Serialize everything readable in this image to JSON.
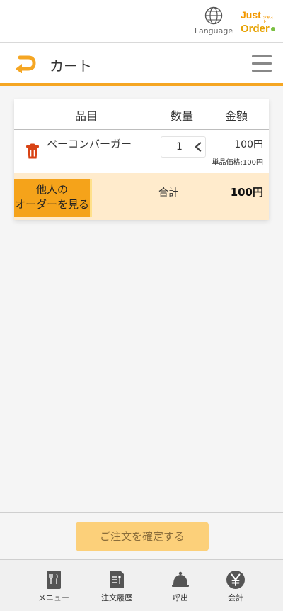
{
  "language": {
    "label": "Language"
  },
  "logo": {
    "line1": "Just",
    "line2": "Order",
    "small1": "ジャスト",
    "small2": "オーダー"
  },
  "header": {
    "title": "カート"
  },
  "cart": {
    "columns": {
      "item": "品目",
      "qty": "数量",
      "price": "金額"
    },
    "items": [
      {
        "name": "ベーコンバーガー",
        "qty": "1",
        "price": "100円",
        "unit_price": "単品価格:100円"
      }
    ],
    "others_button": {
      "line1": "他人の",
      "line2": "オーダーを見る"
    },
    "total_label": "合計",
    "total_value": "100円"
  },
  "confirm_button": "ご注文を確定する",
  "tabs": [
    {
      "label": "メニュー"
    },
    {
      "label": "注文履歴"
    },
    {
      "label": "呼出"
    },
    {
      "label": "会計"
    }
  ],
  "colors": {
    "accent": "#f5a623",
    "total_bg": "#ffebcc",
    "trash": "#d84315"
  }
}
